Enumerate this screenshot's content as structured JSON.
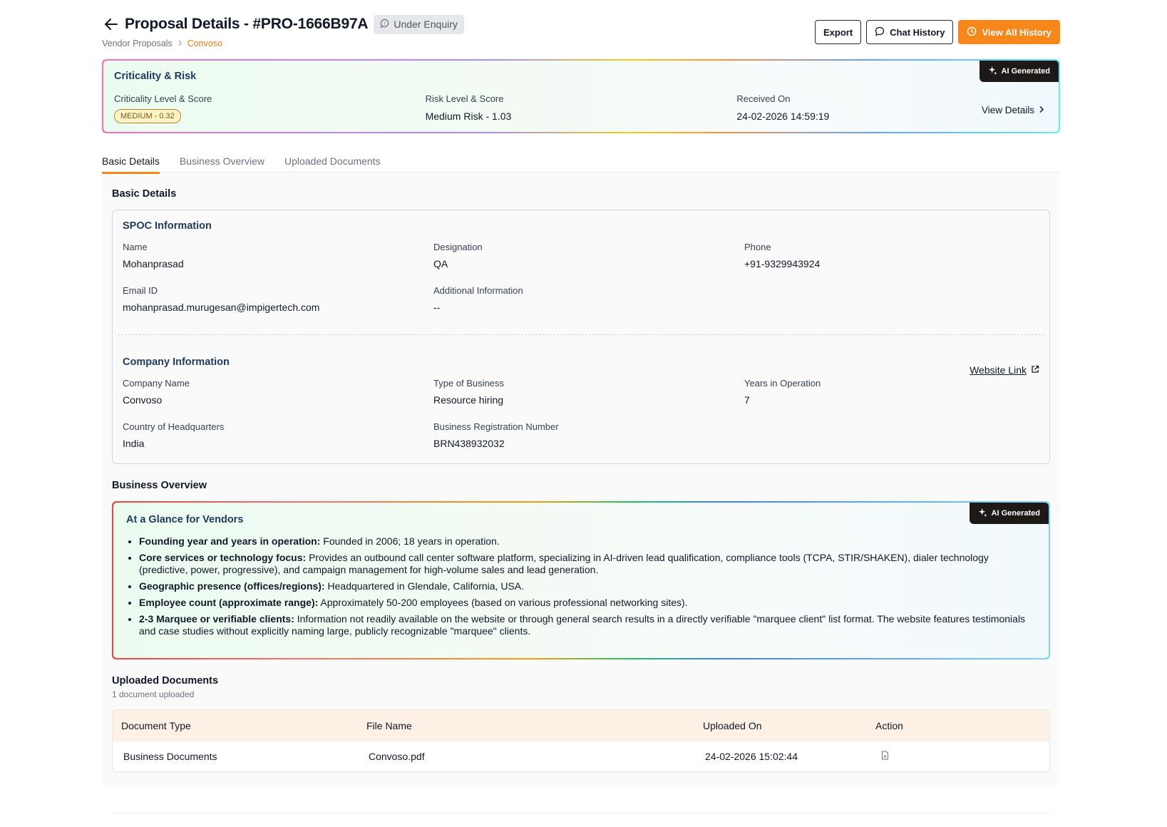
{
  "header": {
    "title": "Proposal Details - #PRO-1666B97A",
    "status": "Under Enquiry",
    "breadcrumb": {
      "parent": "Vendor Proposals",
      "current": "Convoso"
    },
    "actions": {
      "export": "Export",
      "chat_history": "Chat History",
      "view_all_history": "View All History"
    }
  },
  "criticality": {
    "heading": "Criticality & Risk",
    "ai_badge": "AI Generated",
    "criticality_label": "Criticality Level & Score",
    "criticality_value": "MEDIUM - 0.32",
    "risk_label": "Risk Level & Score",
    "risk_value": "Medium Risk - 1.03",
    "received_label": "Received On",
    "received_value": "24-02-2026 14:59:19",
    "view_details": "View Details"
  },
  "tabs": [
    "Basic Details",
    "Business Overview",
    "Uploaded Documents"
  ],
  "basic": {
    "title": "Basic Details",
    "spoc": {
      "heading": "SPOC Information",
      "name_label": "Name",
      "name": "Mohanprasad",
      "designation_label": "Designation",
      "designation": "QA",
      "phone_label": "Phone",
      "phone": "+91-9329943924",
      "email_label": "Email ID",
      "email": "mohanprasad.murugesan@impigertech.com",
      "additional_label": "Additional Information",
      "additional": "--"
    },
    "company": {
      "heading": "Company Information",
      "website_link": "Website Link",
      "company_name_label": "Company Name",
      "company_name": "Convoso",
      "type_label": "Type of Business",
      "type": "Resource hiring",
      "years_label": "Years in Operation",
      "years": "7",
      "country_label": "Country of Headquarters",
      "country": "India",
      "brn_label": "Business Registration Number",
      "brn": "BRN438932032"
    }
  },
  "overview": {
    "title": "Business Overview",
    "card_heading": "At a Glance for Vendors",
    "ai_badge": "AI Generated",
    "bullets": [
      {
        "label": "Founding year and years in operation:",
        "text": " Founded in 2006; 18 years in operation."
      },
      {
        "label": "Core services or technology focus:",
        "text": " Provides an outbound call center software platform, specializing in AI-driven lead qualification, compliance tools (TCPA, STIR/SHAKEN), dialer technology (predictive, power, progressive), and campaign management for high-volume sales and lead generation."
      },
      {
        "label": "Geographic presence (offices/regions):",
        "text": " Headquartered in Glendale, California, USA."
      },
      {
        "label": "Employee count (approximate range):",
        "text": " Approximately 50-200 employees (based on various professional networking sites)."
      },
      {
        "label": "2-3 Marquee or verifiable clients:",
        "text": " Information not readily available on the website or through general search results in a directly verifiable \"marquee client\" list format. The website features testimonials and case studies without explicitly naming large, publicly recognizable \"marquee\" clients."
      }
    ]
  },
  "documents": {
    "title": "Uploaded Documents",
    "subtitle": "1 document uploaded",
    "columns": [
      "Document Type",
      "File Name",
      "Uploaded On",
      "Action"
    ],
    "rows": [
      {
        "type": "Business Documents",
        "file": "Convoso.pdf",
        "uploaded": "24-02-2026 15:02:44",
        "action_icon": "file-icon"
      }
    ]
  },
  "colors": {
    "accent": "#f7861b",
    "heading_blue": "#1e3a5f",
    "table_header_bg": "#fdf0e4"
  }
}
